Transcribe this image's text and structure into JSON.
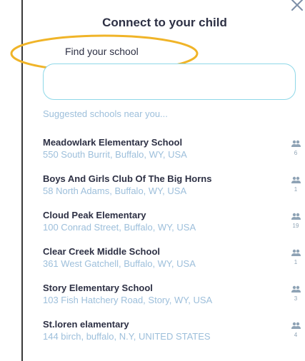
{
  "modal": {
    "title": "Connect to your child",
    "close_icon": "close-icon"
  },
  "search": {
    "label": "Find your school",
    "value": "",
    "placeholder": ""
  },
  "suggested_heading": "Suggested schools near you...",
  "colors": {
    "title_text": "#2d3044",
    "muted_text": "#9dbfdb",
    "input_border": "#8fd8e8",
    "highlight_ellipse": "#f0b428",
    "count_icon": "#8fa3b5"
  },
  "schools": [
    {
      "name": "Meadowlark Elementary School",
      "address": "550 South Burrit, Buffalo, WY, USA",
      "members": "6",
      "icon": "users-icon"
    },
    {
      "name": "Boys And Girls Club Of The Big Horns",
      "address": "58 North Adams, Buffalo, WY, USA",
      "members": "1",
      "icon": "users-icon"
    },
    {
      "name": "Cloud Peak Elementary",
      "address": "100 Conrad Street, Buffalo, WY, USA",
      "members": "19",
      "icon": "users-icon"
    },
    {
      "name": "Clear Creek Middle School",
      "address": "361 West Gatchell, Buffalo, WY, USA",
      "members": "1",
      "icon": "users-icon"
    },
    {
      "name": "Story Elementary School",
      "address": "103 Fish Hatchery Road, Story, WY, USA",
      "members": "3",
      "icon": "users-icon"
    },
    {
      "name": "St.loren elamentary",
      "address": "144 birch, buffalo, N.Y, UNITED STATES",
      "members": "4",
      "icon": "users-icon"
    }
  ]
}
